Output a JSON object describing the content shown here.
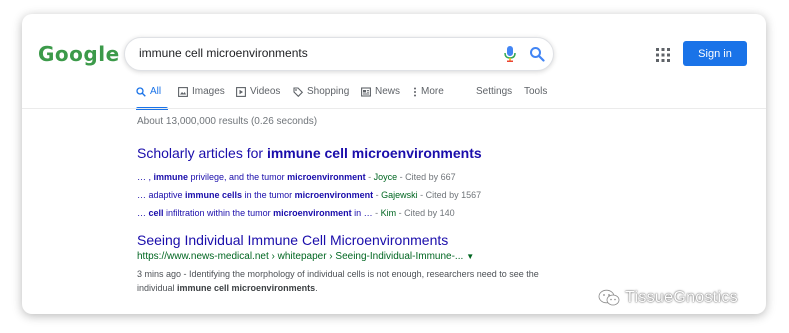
{
  "logo": "Google",
  "search": {
    "query": "immune cell microenvironments"
  },
  "header": {
    "sign_in_label": "Sign in"
  },
  "tabs": [
    {
      "label": "All",
      "icon": "search-icon",
      "active": true
    },
    {
      "label": "Images",
      "icon": "image-icon"
    },
    {
      "label": "Videos",
      "icon": "video-icon"
    },
    {
      "label": "Shopping",
      "icon": "tag-icon"
    },
    {
      "label": "News",
      "icon": "news-icon"
    },
    {
      "label": "More",
      "icon": "more-vert-icon"
    },
    {
      "label": "Settings"
    },
    {
      "label": "Tools"
    }
  ],
  "stats": "About 13,000,000 results (0.26 seconds)",
  "scholar": {
    "title_prefix": "Scholarly articles for ",
    "title_bold": "immune cell microenvironments",
    "items": [
      {
        "parts": [
          {
            "t": "… , ",
            "b": false
          },
          {
            "t": "immune",
            "b": true
          },
          {
            "t": " privilege, and the tumor ",
            "b": false
          },
          {
            "t": "microenvironment",
            "b": true
          }
        ],
        "author": "Joyce",
        "cited": "Cited by 667"
      },
      {
        "parts": [
          {
            "t": "… adaptive ",
            "b": false
          },
          {
            "t": "immune cells",
            "b": true
          },
          {
            "t": " in the tumor ",
            "b": false
          },
          {
            "t": "microenvironment",
            "b": true
          }
        ],
        "author": "Gajewski",
        "cited": "Cited by 1567"
      },
      {
        "parts": [
          {
            "t": "… ",
            "b": false
          },
          {
            "t": "cell",
            "b": true
          },
          {
            "t": " infiltration within the tumor ",
            "b": false
          },
          {
            "t": "microenvironment",
            "b": true
          },
          {
            "t": " in …",
            "b": false
          }
        ],
        "author": "Kim",
        "cited": "Cited by 140"
      }
    ]
  },
  "result": {
    "title": "Seeing Individual Immune Cell Microenvironments",
    "url": "https://www.news-medical.net › whitepaper › Seeing-Individual-Immune-...",
    "snippet_parts": [
      {
        "t": "3 mins ago - Identifying the morphology of individual cells is not enough, researchers need to see the individual ",
        "b": false
      },
      {
        "t": "immune cell microenvironments",
        "b": true
      },
      {
        "t": ".",
        "b": false
      }
    ]
  },
  "watermark": "TissueGnostics",
  "colors": {
    "link": "#1a0dab",
    "url_green": "#006621",
    "accent_blue": "#1a73e8",
    "logo_green": "#3c9a4a"
  }
}
